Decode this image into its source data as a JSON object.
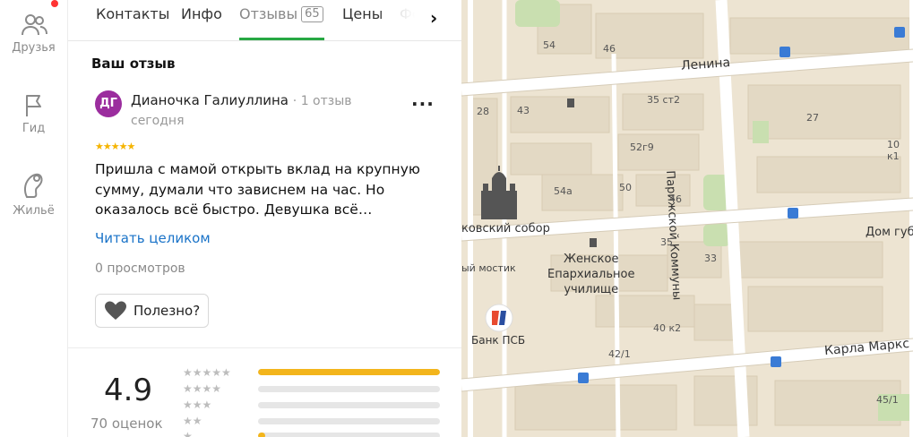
{
  "rail": {
    "items": [
      {
        "label": "Друзья",
        "icon": "friends-icon"
      },
      {
        "label": "Гид",
        "icon": "flag-icon"
      },
      {
        "label": "Жильё",
        "icon": "housing-icon"
      }
    ]
  },
  "tabs": {
    "items": [
      {
        "label": "Контакты"
      },
      {
        "label": "Инфо"
      },
      {
        "label": "Отзывы",
        "badge": "65"
      },
      {
        "label": "Цены"
      },
      {
        "label": "Фо"
      }
    ],
    "active": "Отзывы"
  },
  "review": {
    "section_title": "Ваш отзыв",
    "avatar_initials": "ДГ",
    "author": "Дианочка Галиуллина",
    "author_meta": "· 1 отзыв",
    "date": "сегодня",
    "stars": "★★★★★",
    "rating": 5,
    "text": "Пришла с мамой открыть вклад на крупную сумму, думали что зависнем на час. Но оказалось всё быстро. Девушка всё…",
    "read_more": "Читать целиком",
    "views": "0 просмотров",
    "useful_label": "Полезно?"
  },
  "summary": {
    "rating": "4.9",
    "count": "70 оценок",
    "distribution": [
      {
        "stars": "★★★★★",
        "fraction": 1.0
      },
      {
        "stars": "★★★★",
        "fraction": 0.0
      },
      {
        "stars": "★★★",
        "fraction": 0.0
      },
      {
        "stars": "★★",
        "fraction": 0.0
      },
      {
        "stars": "★",
        "fraction": 0.04
      }
    ]
  },
  "map": {
    "labels": {
      "street_lenina": "Ленина",
      "street_parizhskoy": "Парижской Коммуны",
      "street_karla": "Карла Маркс",
      "sobor": "ковский собор",
      "mostik": "ый мостик",
      "school": "Женское\nЕпархиальное\nучилище",
      "bank": "Банк ПСБ",
      "dom": "Дом губ"
    },
    "numbers": [
      "54",
      "46",
      "28",
      "43",
      "35 ст2",
      "27",
      "10 к1",
      "52г9",
      "54а",
      "50",
      "46",
      "35",
      "33",
      "40 к2",
      "42/1",
      "45/1"
    ]
  },
  "colors": {
    "accent_green": "#27a843",
    "link_blue": "#1a73c8",
    "star_gold": "#f5b400",
    "avatar_purple": "#9b2d9e",
    "notification_red": "#ff3333"
  }
}
